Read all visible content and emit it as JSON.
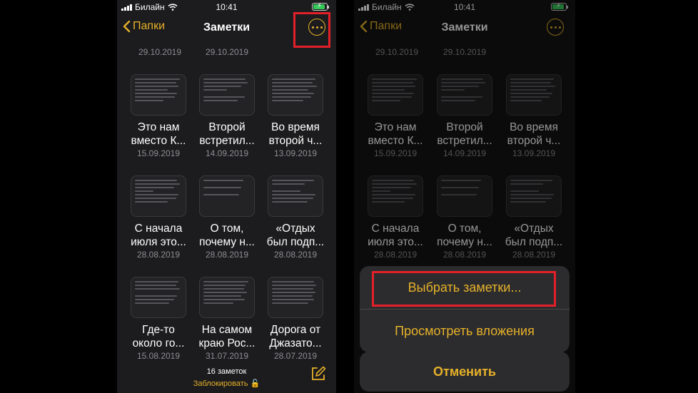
{
  "status": {
    "carrier": "Билайн",
    "time": "10:41"
  },
  "nav": {
    "back_label": "Папки",
    "title": "Заметки"
  },
  "top_dates": [
    "29.10.2019",
    "29.10.2019"
  ],
  "notes": [
    {
      "title1": "Это нам",
      "title2": "вместо К...",
      "date": "15.09.2019"
    },
    {
      "title1": "Второй",
      "title2": "встретил...",
      "date": "14.09.2019"
    },
    {
      "title1": "Во время",
      "title2": "второй ч...",
      "date": "13.09.2019"
    },
    {
      "title1": "С начала",
      "title2": "июля это...",
      "date": "28.08.2019"
    },
    {
      "title1": "О том,",
      "title2": "почему н...",
      "date": "28.08.2019"
    },
    {
      "title1": "«Отдых",
      "title2": "был подп...",
      "date": "28.08.2019"
    },
    {
      "title1": "Где-то",
      "title2": "около го...",
      "date": "15.08.2019"
    },
    {
      "title1": "На самом",
      "title2": "краю Рос...",
      "date": "31.07.2019"
    },
    {
      "title1": "Дорога от",
      "title2": "Джазато...",
      "date": "28.07.2019"
    }
  ],
  "footer": {
    "count": "16 заметок",
    "lock_label": "Заблокировать"
  },
  "action_sheet": {
    "select_notes": "Выбрать заметки...",
    "view_attachments": "Просмотреть вложения",
    "cancel": "Отменить"
  },
  "colors": {
    "accent": "#e6b12a",
    "highlight": "#e3202a"
  }
}
